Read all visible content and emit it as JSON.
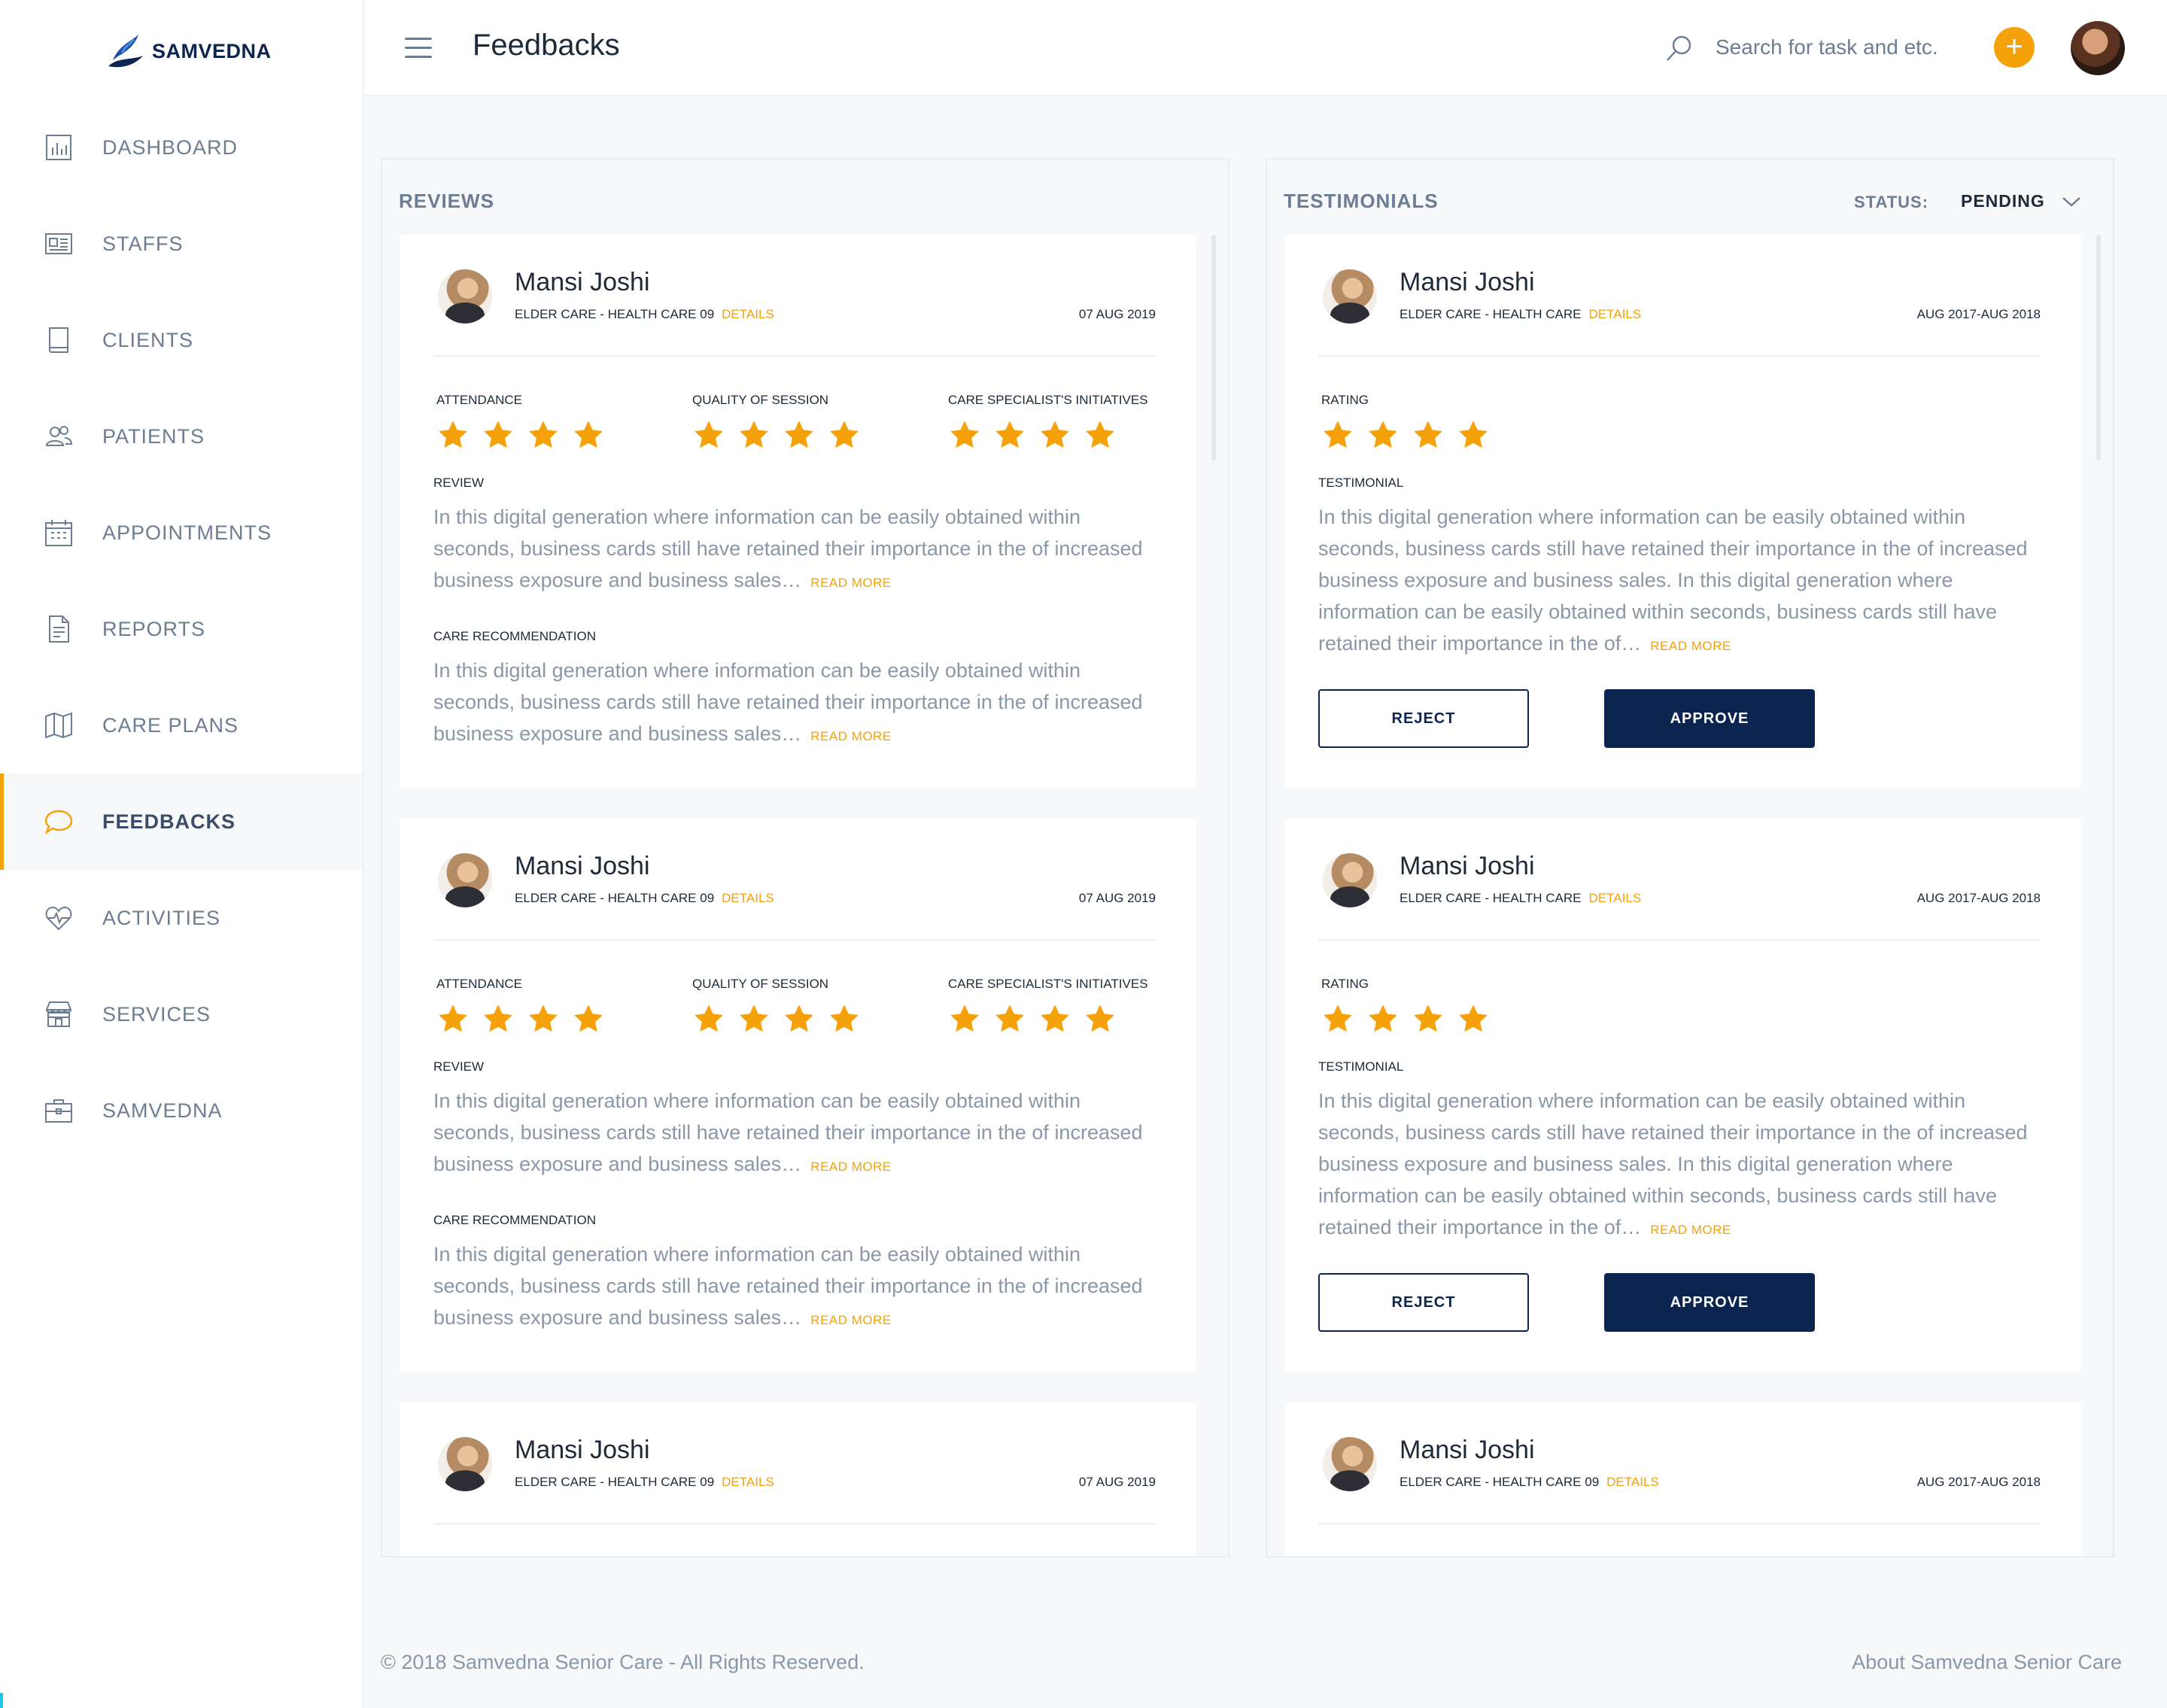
{
  "brand": {
    "name": "SAMVEDNA"
  },
  "colors": {
    "accent": "#f5a10a",
    "primary": "#0c2550",
    "muted": "#6b7c93",
    "text_light": "#8a97a8"
  },
  "sidebar": {
    "items": [
      {
        "label": "DASHBOARD",
        "icon": "chart-icon",
        "active": false
      },
      {
        "label": "STAFFS",
        "icon": "id-card-icon",
        "active": false
      },
      {
        "label": "CLIENTS",
        "icon": "book-icon",
        "active": false
      },
      {
        "label": "PATIENTS",
        "icon": "users-icon",
        "active": false
      },
      {
        "label": "APPOINTMENTS",
        "icon": "calendar-icon",
        "active": false
      },
      {
        "label": "REPORTS",
        "icon": "document-icon",
        "active": false
      },
      {
        "label": "CARE PLANS",
        "icon": "map-icon",
        "active": false
      },
      {
        "label": "FEEDBACKS",
        "icon": "chat-bubble-icon",
        "active": true
      },
      {
        "label": "ACTIVITIES",
        "icon": "heart-pulse-icon",
        "active": false
      },
      {
        "label": "SERVICES",
        "icon": "store-icon",
        "active": false
      },
      {
        "label": "SAMVEDNA",
        "icon": "briefcase-icon",
        "active": false
      }
    ]
  },
  "header": {
    "title": "Feedbacks",
    "search_placeholder": "Search for task and etc.",
    "add_label": "+"
  },
  "reviews": {
    "title": "REVIEWS",
    "cards": [
      {
        "name": "Mansi Joshi",
        "subtitle": "ELDER CARE - HEALTH CARE 09",
        "details": "DETAILS",
        "date": "07 AUG 2019",
        "ratings": [
          {
            "label": "ATTENDANCE",
            "stars": 4
          },
          {
            "label": "QUALITY OF SESSION",
            "stars": 4
          },
          {
            "label": "CARE SPECIALIST'S INITIATIVES",
            "stars": 4
          }
        ],
        "review_label": "REVIEW",
        "review_text": "In this digital generation where information can be easily obtained within seconds, business cards still have retained their importance in the of increased business exposure and business sales…",
        "care_label": "CARE RECOMMENDATION",
        "care_text": "In this digital generation where information can be easily obtained within seconds, business cards still have retained their importance in the of increased business exposure and business sales…",
        "read_more": "READ MORE"
      },
      {
        "name": "Mansi Joshi",
        "subtitle": "ELDER CARE - HEALTH CARE 09",
        "details": "DETAILS",
        "date": "07 AUG 2019",
        "ratings": [
          {
            "label": "ATTENDANCE",
            "stars": 4
          },
          {
            "label": "QUALITY OF SESSION",
            "stars": 4
          },
          {
            "label": "CARE SPECIALIST'S INITIATIVES",
            "stars": 4
          }
        ],
        "review_label": "REVIEW",
        "review_text": "In this digital generation where information can be easily obtained within seconds, business cards still have retained their importance in the of increased business exposure and business sales…",
        "care_label": "CARE RECOMMENDATION",
        "care_text": "In this digital generation where information can be easily obtained within seconds, business cards still have retained their importance in the of increased business exposure and business sales…",
        "read_more": "READ MORE"
      },
      {
        "name": "Mansi Joshi",
        "subtitle": "ELDER CARE - HEALTH CARE 09",
        "details": "DETAILS",
        "date": "07 AUG 2019"
      }
    ]
  },
  "testimonials": {
    "title": "TESTIMONIALS",
    "status_label": "STATUS:",
    "status_value": "PENDING",
    "cards": [
      {
        "name": "Mansi Joshi",
        "subtitle": "ELDER CARE - HEALTH CARE",
        "details": "DETAILS",
        "date": "AUG 2017-AUG 2018",
        "rating_label": "RATING",
        "stars": 4,
        "testimonial_label": "TESTIMONIAL",
        "testimonial_text": "In this digital generation where information can be easily obtained within seconds, business cards still have retained their importance in the of increased business exposure and business sales. In this digital generation where information can be easily obtained within seconds, business cards still have retained their importance in the of…",
        "read_more": "READ MORE",
        "reject": "REJECT",
        "approve": "APPROVE"
      },
      {
        "name": "Mansi Joshi",
        "subtitle": "ELDER CARE - HEALTH CARE",
        "details": "DETAILS",
        "date": "AUG 2017-AUG 2018",
        "rating_label": "RATING",
        "stars": 4,
        "testimonial_label": "TESTIMONIAL",
        "testimonial_text": "In this digital generation where information can be easily obtained within seconds, business cards still have retained their importance in the of increased business exposure and business sales. In this digital generation where information can be easily obtained within seconds, business cards still have retained their importance in the of…",
        "read_more": "READ MORE",
        "reject": "REJECT",
        "approve": "APPROVE"
      },
      {
        "name": "Mansi Joshi",
        "subtitle": "ELDER CARE - HEALTH CARE 09",
        "details": "DETAILS",
        "date": "AUG 2017-AUG 2018"
      }
    ]
  },
  "footer": {
    "copyright": "© 2018 Samvedna Senior Care - All Rights Reserved.",
    "about": "About Samvedna Senior Care"
  }
}
